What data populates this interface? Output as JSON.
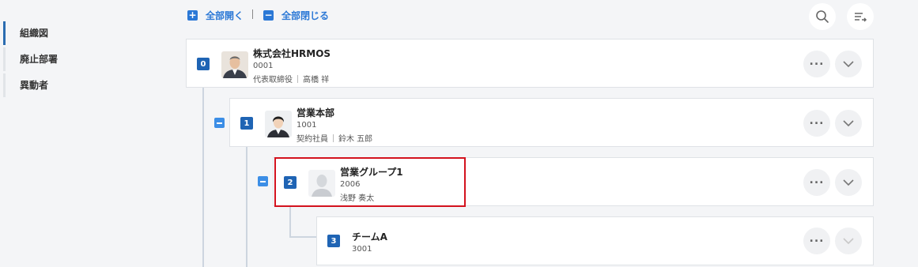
{
  "sidebar": {
    "items": [
      {
        "label": "組織図"
      },
      {
        "label": "廃止部署"
      },
      {
        "label": "異動者"
      }
    ]
  },
  "toolbar": {
    "expand_all": "全部開く",
    "collapse_all": "全部閉じる"
  },
  "nodes": [
    {
      "level": "0",
      "name": "株式会社HRMOS",
      "code": "0001",
      "role": "代表取締役",
      "person": "高橋 祥"
    },
    {
      "level": "1",
      "name": "営業本部",
      "code": "1001",
      "role": "契約社員",
      "person": "鈴木 五郎"
    },
    {
      "level": "2",
      "name": "営業グループ1",
      "code": "2006",
      "person": "浅野 奏太"
    },
    {
      "level": "3",
      "name": "チームA",
      "code": "3001"
    }
  ],
  "colors": {
    "accent": "#2b78d6",
    "badge": "#1f64b4",
    "highlight": "#d3121e"
  }
}
